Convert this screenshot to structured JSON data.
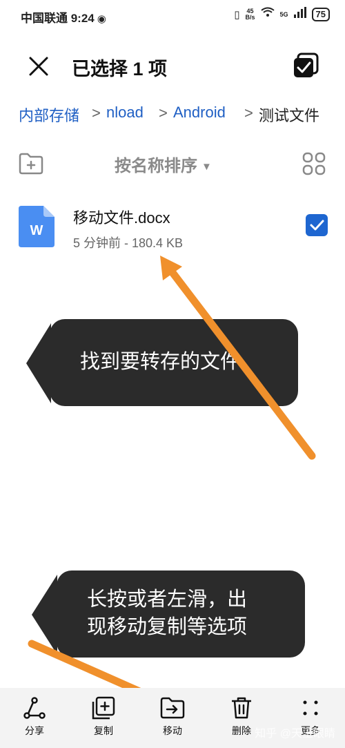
{
  "status_bar": {
    "carrier_time": "中国联通 9:24",
    "net_speed_value": "45",
    "net_speed_unit": "B/s",
    "network_type": "5G",
    "battery": "75"
  },
  "header": {
    "title": "已选择 1 项"
  },
  "breadcrumb": {
    "items": [
      "内部存储",
      "nload",
      "Android",
      "测试文件"
    ],
    "separator": ">"
  },
  "toolbar": {
    "sort_label": "按名称排序",
    "sort_caret": "▼"
  },
  "file": {
    "icon_letter": "W",
    "name": "移动文件.docx",
    "meta": "5 分钟前 - 180.4 KB",
    "selected": true
  },
  "annotations": {
    "bubble_1": "找到要转存的文件",
    "bubble_2_line_1": "长按或者左滑，出",
    "bubble_2_line_2": "现移动复制等选项",
    "arrow_color": "#f0902c"
  },
  "bottom_actions": [
    {
      "label": "分享",
      "icon": "share-icon"
    },
    {
      "label": "复制",
      "icon": "copy-icon"
    },
    {
      "label": "移动",
      "icon": "move-icon"
    },
    {
      "label": "删除",
      "icon": "delete-icon"
    },
    {
      "label": "更多",
      "icon": "more-icon"
    }
  ],
  "watermark": "知乎 @天王眼睛",
  "colors": {
    "accent": "#1e66d0",
    "link": "#1f5fc4",
    "bubble": "#2b2b2b",
    "bottom_bar": "#f3f3f3"
  }
}
